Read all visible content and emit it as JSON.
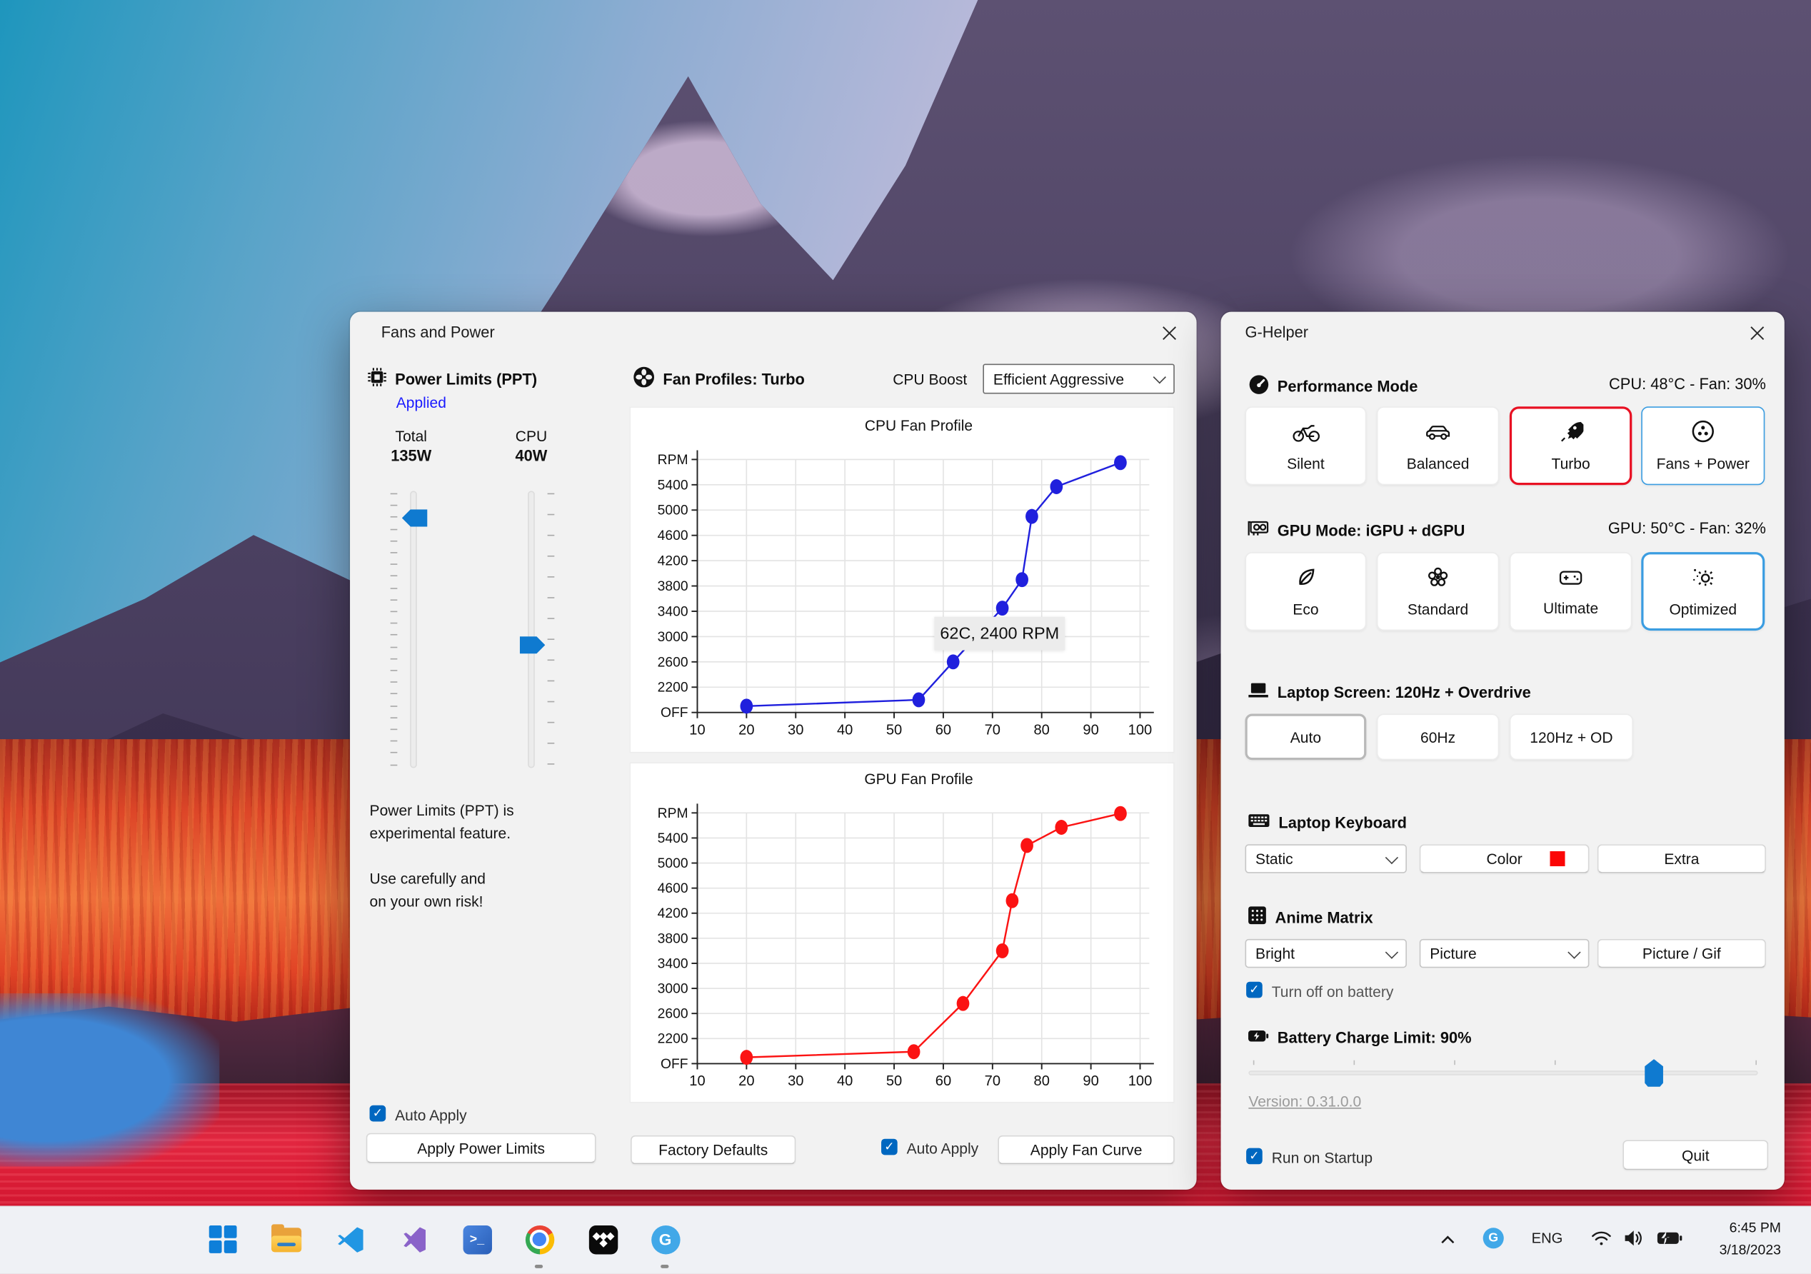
{
  "colors": {
    "accent_blue": "#0078d4",
    "selection_red": "#e81123",
    "selection_blue": "#3b9de1",
    "applied_link_blue": "#1a1aff",
    "checkbox_blue": "#0067c0",
    "cpu_line": "#2020dd",
    "gpu_line": "#fb1313",
    "keyboard_color_swatch": "#fb0606"
  },
  "chart_data": [
    {
      "type": "line",
      "title": "CPU Fan Profile",
      "ylabel": "RPM",
      "xlabel": "",
      "x_range": [
        10,
        100
      ],
      "x_ticks": [
        10,
        20,
        30,
        40,
        50,
        60,
        70,
        80,
        90,
        100
      ],
      "y_tick_labels": [
        "OFF",
        "2200",
        "2600",
        "3000",
        "3400",
        "3800",
        "4200",
        "4600",
        "5000",
        "5400",
        "RPM"
      ],
      "y_value_range": [
        1800,
        5800
      ],
      "grid": true,
      "series_color_key": "cpu_line",
      "points": [
        [
          20,
          1900
        ],
        [
          55,
          2000
        ],
        [
          62,
          2600
        ],
        [
          72,
          3450
        ],
        [
          76,
          3900
        ],
        [
          78,
          4900
        ],
        [
          83,
          5370
        ],
        [
          96,
          5750
        ]
      ],
      "annotation": "62C, 2400 RPM"
    },
    {
      "type": "line",
      "title": "GPU Fan Profile",
      "ylabel": "RPM",
      "xlabel": "",
      "x_range": [
        10,
        100
      ],
      "x_ticks": [
        10,
        20,
        30,
        40,
        50,
        60,
        70,
        80,
        90,
        100
      ],
      "y_tick_labels": [
        "OFF",
        "2200",
        "2600",
        "3000",
        "3400",
        "3800",
        "4200",
        "4600",
        "5000",
        "5400",
        "RPM"
      ],
      "y_value_range": [
        1800,
        5800
      ],
      "grid": true,
      "series_color_key": "gpu_line",
      "points": [
        [
          20,
          1900
        ],
        [
          54,
          1990
        ],
        [
          64,
          2760
        ],
        [
          72,
          3600
        ],
        [
          74,
          4400
        ],
        [
          77,
          5280
        ],
        [
          84,
          5570
        ],
        [
          96,
          5790
        ]
      ]
    }
  ],
  "fans_window": {
    "title": "Fans and Power",
    "power_limits": {
      "heading": "Power Limits (PPT)",
      "status": "Applied",
      "sliders": [
        {
          "label": "Total",
          "value": "135W"
        },
        {
          "label": "CPU",
          "value": "40W"
        }
      ],
      "note_lines": [
        "Power Limits (PPT) is",
        "experimental feature.",
        "Use carefully and",
        "on your own risk!"
      ],
      "auto_apply_label": "Auto Apply",
      "apply_button": "Apply Power Limits"
    },
    "fan_profiles": {
      "heading": "Fan Profiles: Turbo",
      "cpu_boost_label": "CPU Boost",
      "cpu_boost_value": "Efficient Aggressive",
      "factory_defaults_button": "Factory Defaults",
      "auto_apply_label": "Auto Apply",
      "apply_fan_curve_button": "Apply Fan Curve"
    }
  },
  "ghelper_window": {
    "title": "G-Helper",
    "performance_mode": {
      "heading": "Performance Mode",
      "status": "CPU: 48°C -  Fan: 30%",
      "buttons": [
        {
          "label": "Silent"
        },
        {
          "label": "Balanced"
        },
        {
          "label": "Turbo",
          "selected": true
        },
        {
          "label": "Fans + Power",
          "highlighted": true
        }
      ]
    },
    "gpu_mode": {
      "heading": "GPU Mode: iGPU + dGPU",
      "status": "GPU: 50°C -  Fan: 32%",
      "buttons": [
        {
          "label": "Eco"
        },
        {
          "label": "Standard"
        },
        {
          "label": "Ultimate"
        },
        {
          "label": "Optimized",
          "selected": true
        }
      ]
    },
    "screen": {
      "heading": "Laptop Screen: 120Hz + Overdrive",
      "buttons": [
        {
          "label": "Auto",
          "selected": true
        },
        {
          "label": "60Hz"
        },
        {
          "label": "120Hz + OD"
        }
      ]
    },
    "keyboard": {
      "heading": "Laptop Keyboard",
      "mode_value": "Static",
      "color_button": "Color",
      "extra_button": "Extra"
    },
    "anime_matrix": {
      "heading": "Anime Matrix",
      "brightness_value": "Bright",
      "mode_value": "Picture",
      "picture_gif_button": "Picture / Gif",
      "battery_checkbox_label": "Turn off on battery"
    },
    "battery": {
      "heading": "Battery Charge Limit: 90%"
    },
    "version_link": "Version: 0.31.0.0",
    "run_on_startup_label": "Run on Startup",
    "quit_button": "Quit"
  },
  "taskbar": {
    "apps": [
      "windows-start",
      "file-explorer",
      "vscode",
      "visual-studio",
      "powershell",
      "chrome",
      "tidal",
      "g-helper"
    ],
    "tray": {
      "language": "ENG",
      "time": "6:45 PM",
      "date": "3/18/2023"
    }
  }
}
